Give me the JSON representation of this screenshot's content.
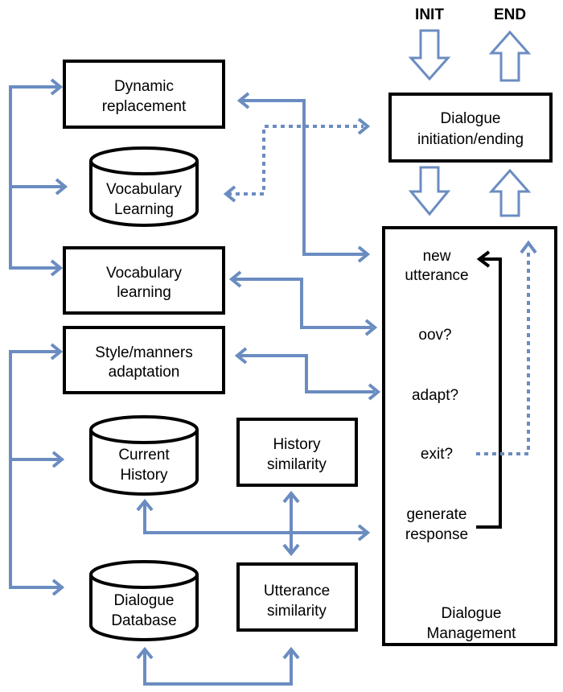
{
  "labels": {
    "init": "INIT",
    "end": "END",
    "dynamic_replacement": [
      "Dynamic",
      "replacement"
    ],
    "vocabulary_learning_db": [
      "Vocabulary",
      "Learning"
    ],
    "vocabulary_learning": [
      "Vocabulary",
      "learning"
    ],
    "style_adaptation": [
      "Style/manners",
      "adaptation"
    ],
    "current_history": [
      "Current",
      "History"
    ],
    "history_similarity": [
      "History",
      "similarity"
    ],
    "dialogue_database": [
      "Dialogue",
      "Database"
    ],
    "utterance_similarity": [
      "Utterance",
      "similarity"
    ],
    "dialogue_initiation": [
      "Dialogue",
      "initiation/ending"
    ],
    "dm_steps": {
      "new_utterance": [
        "new",
        "utterance"
      ],
      "oov": "oov?",
      "adapt": "adapt?",
      "exit": "exit?",
      "generate_response": [
        "generate",
        "response"
      ]
    },
    "dialogue_management": [
      "Dialogue",
      "Management"
    ]
  },
  "colors": {
    "arrow": "#6b8cc1",
    "box": "#000000"
  }
}
